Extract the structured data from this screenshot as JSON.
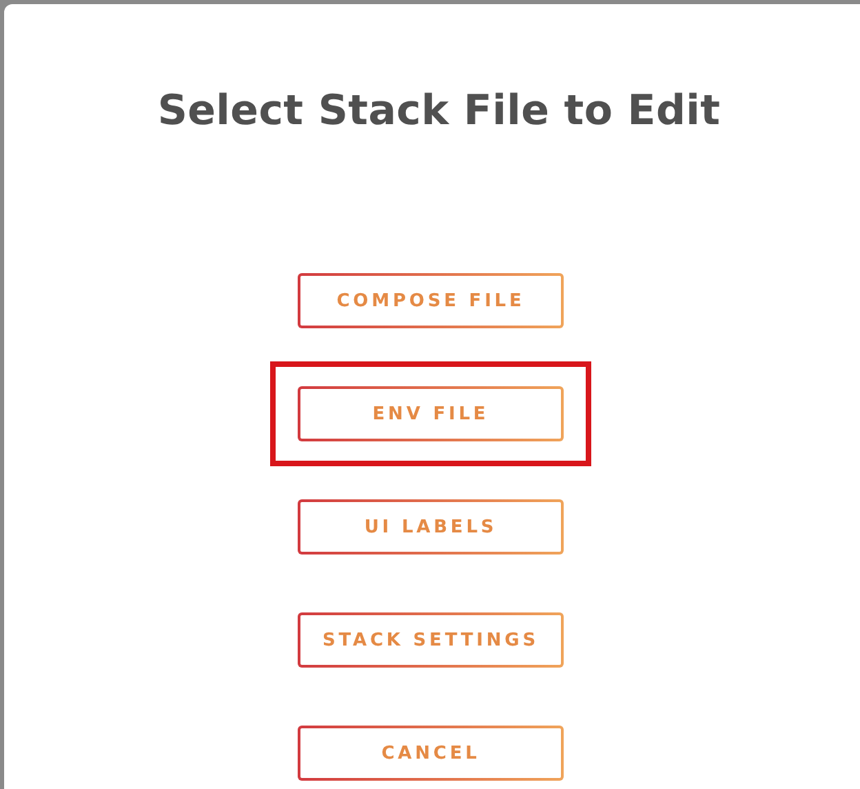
{
  "dialog": {
    "title": "Select Stack File to Edit"
  },
  "buttons": [
    {
      "label": "COMPOSE FILE",
      "highlighted": false
    },
    {
      "label": "ENV FILE",
      "highlighted": true
    },
    {
      "label": "UI LABELS",
      "highlighted": false
    },
    {
      "label": "STACK SETTINGS",
      "highlighted": false
    },
    {
      "label": "CANCEL",
      "highlighted": false
    }
  ]
}
